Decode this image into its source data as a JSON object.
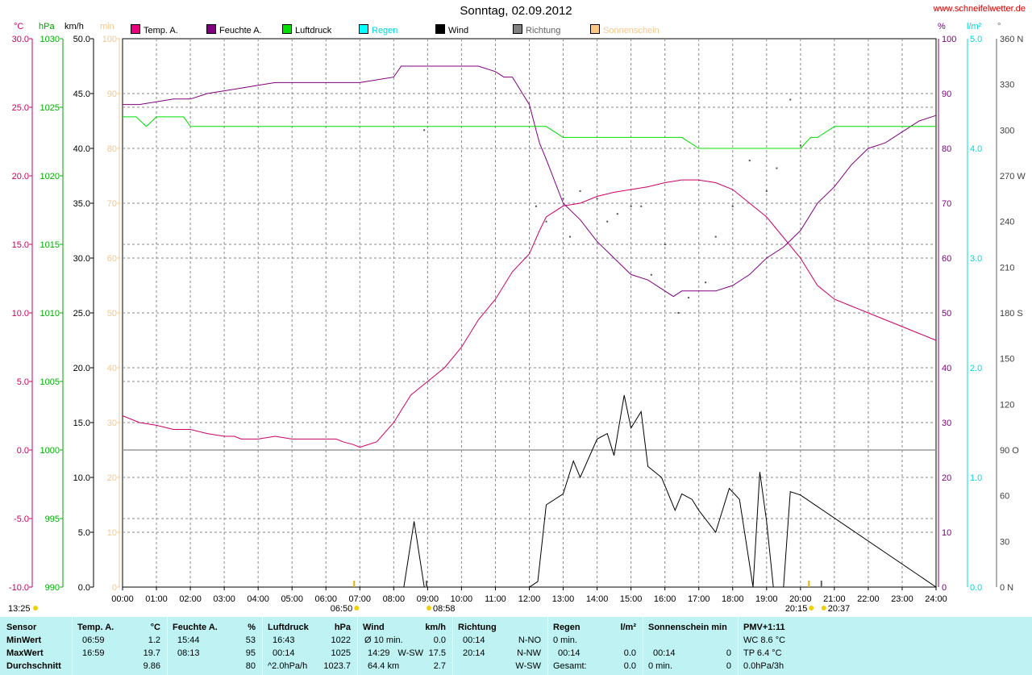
{
  "site": "www.schneifelwetter.de",
  "title": "Sonntag, 02.09.2012",
  "legend": [
    {
      "label": "Temp. A.",
      "color": "#e8007f"
    },
    {
      "label": "Feuchte A.",
      "color": "#800080"
    },
    {
      "label": "Luftdruck",
      "color": "#00e000"
    },
    {
      "label": "Regen",
      "color": "#00ffff"
    },
    {
      "label": "Wind",
      "color": "#000000"
    },
    {
      "label": "Richtung",
      "color": "#808080"
    },
    {
      "label": "Sonnenschein",
      "color": "#ffc880"
    }
  ],
  "axis_titles": {
    "temp": "°C",
    "pressure": "hPa",
    "wind": "km/h",
    "sun": "min",
    "humidity": "%",
    "rain": "l/m²",
    "direction": "°"
  },
  "colors": {
    "temp": "#cc0066",
    "humidity": "#800080",
    "pressure": "#00c000",
    "rain": "#00d8d8",
    "wind": "#000000",
    "direction": "#606060",
    "sun": "#f0c890",
    "statsbg": "#bff3f3"
  },
  "chart_data": {
    "type": "line",
    "x_label_ticks": [
      "00:00",
      "01:00",
      "02:00",
      "03:00",
      "04:00",
      "05:00",
      "06:00",
      "07:00",
      "08:00",
      "09:00",
      "10:00",
      "11:00",
      "12:00",
      "13:00",
      "14:00",
      "15:00",
      "16:00",
      "17:00",
      "18:00",
      "19:00",
      "20:00",
      "21:00",
      "22:00",
      "23:00",
      "24:00"
    ],
    "x_range_hours": [
      0,
      24
    ],
    "axes": {
      "temp": {
        "ticks": [
          "30.0",
          "25.0",
          "20.0",
          "15.0",
          "10.0",
          "5.0",
          "0.0",
          "-5.0",
          "-10.0"
        ],
        "range": [
          -10,
          30
        ]
      },
      "pressure": {
        "ticks": [
          "1030",
          "1025",
          "1020",
          "1015",
          "1010",
          "1005",
          "1000",
          "995",
          "990"
        ],
        "range": [
          990,
          1030
        ]
      },
      "wind": {
        "ticks": [
          "50.0",
          "45.0",
          "40.0",
          "35.0",
          "30.0",
          "25.0",
          "20.0",
          "15.0",
          "10.0",
          "5.0",
          "0.0"
        ],
        "range": [
          0,
          50
        ]
      },
      "sun": {
        "ticks": [
          "100",
          "90",
          "80",
          "70",
          "60",
          "50",
          "40",
          "30",
          "20",
          "10",
          "0"
        ],
        "range": [
          0,
          100
        ]
      },
      "humidity": {
        "ticks": [
          "100",
          "90",
          "80",
          "70",
          "60",
          "50",
          "40",
          "30",
          "20",
          "10",
          "0"
        ],
        "range": [
          0,
          100
        ]
      },
      "rain": {
        "ticks": [
          "5.0",
          "4.0",
          "3.0",
          "2.0",
          "1.0",
          "0.0"
        ],
        "range": [
          0,
          5
        ]
      },
      "direction": {
        "ticks": [
          "360 N",
          "330",
          "300",
          "270 W",
          "240",
          "210",
          "180 S",
          "150",
          "120",
          "90 O",
          "60",
          "30",
          "0 N"
        ],
        "range": [
          0,
          360
        ]
      }
    },
    "grid": true,
    "series": [
      {
        "name": "Temp. A.",
        "axis": "temp",
        "x": [
          0,
          0.5,
          1,
          1.5,
          2,
          2.5,
          3,
          3.3,
          3.5,
          4,
          4.5,
          5,
          5.5,
          6,
          6.3,
          6.5,
          6.8,
          7,
          7.5,
          8,
          8.5,
          9,
          9.5,
          10,
          10.5,
          11,
          11.5,
          12,
          12.3,
          12.5,
          13,
          13.5,
          14,
          14.5,
          15,
          15.5,
          16,
          16.5,
          16.98,
          17.5,
          18,
          18.5,
          19,
          19.5,
          20,
          20.5,
          21,
          21.5,
          22,
          22.5,
          23,
          23.5,
          24
        ],
        "y": [
          2.5,
          2.0,
          1.8,
          1.5,
          1.5,
          1.2,
          1.0,
          1.0,
          0.8,
          0.8,
          1.0,
          0.8,
          0.8,
          0.8,
          0.8,
          0.6,
          0.4,
          0.2,
          0.6,
          2.0,
          4.0,
          5.0,
          6.0,
          7.5,
          9.5,
          11.0,
          13.0,
          14.3,
          16.0,
          17.0,
          17.8,
          18.0,
          18.5,
          18.8,
          19.0,
          19.2,
          19.5,
          19.7,
          19.7,
          19.5,
          19.0,
          18.0,
          17.0,
          15.5,
          14.0,
          12.0,
          11.0,
          10.5,
          10.0,
          9.5,
          9.0,
          8.5,
          8.0
        ]
      },
      {
        "name": "Feuchte A.",
        "axis": "humidity",
        "x": [
          0,
          0.5,
          1,
          1.5,
          2,
          2.5,
          3,
          3.5,
          4,
          4.5,
          5,
          5.5,
          6,
          6.5,
          7,
          7.5,
          8,
          8.22,
          8.5,
          9,
          9.5,
          10,
          10.5,
          11,
          11.25,
          11.5,
          12,
          12.3,
          12.5,
          13,
          13.5,
          14,
          14.5,
          15,
          15.5,
          16,
          16.25,
          16.5,
          17,
          17.5,
          18,
          18.5,
          19,
          19.5,
          20,
          20.5,
          21,
          21.5,
          22,
          22.5,
          23,
          23.5,
          24
        ],
        "y": [
          88,
          88,
          88.5,
          89,
          89,
          90,
          90.5,
          91,
          91.5,
          92,
          92,
          92,
          92,
          92,
          92,
          92.5,
          93,
          95,
          95,
          95,
          95,
          95,
          95,
          94,
          93,
          93,
          88,
          81,
          78,
          70,
          67,
          63,
          60,
          57,
          56,
          54,
          53,
          54,
          54,
          54,
          55,
          57,
          60,
          62,
          65,
          70,
          73,
          77,
          80,
          81,
          83,
          85,
          86
        ]
      },
      {
        "name": "Luftdruck",
        "axis": "pressure",
        "x": [
          0,
          0.4,
          0.7,
          1,
          1.5,
          1.8,
          2,
          2.5,
          3,
          4,
          5,
          6,
          7,
          8,
          9,
          10,
          11,
          12,
          12.5,
          13,
          13.5,
          14,
          15,
          16,
          16.5,
          17,
          18,
          19,
          20,
          20.3,
          20.5,
          21,
          22,
          23,
          24
        ],
        "y": [
          1024.3,
          1024.3,
          1023.6,
          1024.3,
          1024.3,
          1024.3,
          1023.6,
          1023.6,
          1023.6,
          1023.6,
          1023.6,
          1023.6,
          1023.6,
          1023.6,
          1023.6,
          1023.6,
          1023.6,
          1023.6,
          1023.6,
          1022.8,
          1022.8,
          1022.8,
          1022.8,
          1022.8,
          1022.8,
          1022.0,
          1022.0,
          1022.0,
          1022.0,
          1022.8,
          1022.8,
          1023.6,
          1023.6,
          1023.6,
          1023.6
        ]
      },
      {
        "name": "Wind",
        "axis": "wind",
        "x": [
          0,
          8.3,
          8.6,
          8.9,
          12,
          12.25,
          12.5,
          13,
          13.3,
          13.5,
          14,
          14.3,
          14.5,
          14.8,
          15,
          15.3,
          15.5,
          15.9,
          16.3,
          16.5,
          16.8,
          17,
          17.5,
          17.9,
          18.2,
          18.6,
          18.8,
          19,
          19.2,
          19.5,
          19.7,
          20,
          24
        ],
        "y": [
          0,
          0,
          6,
          0,
          0,
          0.5,
          7.5,
          8.5,
          11.5,
          10,
          13.5,
          14,
          12,
          17.5,
          14.5,
          16,
          11,
          10,
          7,
          8.5,
          8,
          7,
          5,
          9,
          8,
          0,
          10.5,
          6,
          0,
          0,
          8.7,
          8.4,
          0
        ]
      },
      {
        "name": "Richtung",
        "axis": "direction",
        "x": [
          8.9,
          12.2,
          12.5,
          13,
          13.2,
          13.5,
          14,
          14.3,
          14.6,
          15,
          15.3,
          15.6,
          16,
          16.4,
          16.7,
          17.2,
          17.5,
          18,
          18.5,
          19,
          19.3,
          19.7,
          20
        ],
        "y": [
          300,
          250,
          240,
          255,
          230,
          260,
          255,
          240,
          245,
          250,
          250,
          205,
          225,
          180,
          190,
          200,
          230,
          250,
          280,
          260,
          275,
          320,
          290
        ]
      }
    ],
    "markers": [
      {
        "label": "06:50",
        "hour": 6.833,
        "type": "sunrise"
      },
      {
        "label": "08:58",
        "hour": 8.967,
        "type": "sunrise-ext"
      },
      {
        "label": "20:15",
        "hour": 20.25,
        "type": "sunset"
      },
      {
        "label": "20:37",
        "hour": 20.617,
        "type": "sunset-ext"
      }
    ],
    "time_label": "13:25"
  },
  "stats": {
    "sensor": {
      "header": "Sensor",
      "rows": [
        "MinWert",
        "MaxWert",
        "Durchschnitt"
      ]
    },
    "temp": {
      "header": "Temp. A.",
      "unit": "°C",
      "rows": [
        [
          "06:59",
          "1.2"
        ],
        [
          "16:59",
          "19.7"
        ],
        [
          "",
          "9.86"
        ]
      ]
    },
    "humidity": {
      "header": "Feuchte A.",
      "unit": "%",
      "rows": [
        [
          "15:44",
          "53"
        ],
        [
          "08:13",
          "95"
        ],
        [
          "",
          "80"
        ]
      ]
    },
    "pressure": {
      "header": "Luftdruck",
      "unit": "hPa",
      "rows": [
        [
          "16:43",
          "1022"
        ],
        [
          "00:14",
          "1025"
        ],
        [
          "^2.0hPa/h",
          "1023.7"
        ]
      ]
    },
    "wind": {
      "header": "Wind",
      "unit": "km/h",
      "rows": [
        [
          "Ø 10 min.",
          "",
          "0.0"
        ],
        [
          "14:29",
          "W-SW",
          "17.5"
        ],
        [
          "64.4 km",
          "",
          "2.7"
        ]
      ]
    },
    "direction": {
      "header": "Richtung",
      "rows": [
        [
          "00:14",
          "N-NO"
        ],
        [
          "20:14",
          "N-NW"
        ],
        [
          "",
          "W-SW"
        ]
      ]
    },
    "rain": {
      "header": "Regen",
      "unit": "l/m²",
      "rows": [
        [
          "0 min.",
          ""
        ],
        [
          "00:14",
          "0.0"
        ],
        [
          "Gesamt:",
          "0.0"
        ]
      ]
    },
    "sun": {
      "header": "Sonnenschein min",
      "rows": [
        [
          "",
          ""
        ],
        [
          "00:14",
          "0"
        ],
        [
          "0 min.",
          "0"
        ]
      ]
    },
    "pmv": {
      "header": "PMV+1:11",
      "rows": [
        "WC 8.6 °C",
        "TP 6.4 °C",
        "0.0hPa/3h"
      ]
    }
  }
}
